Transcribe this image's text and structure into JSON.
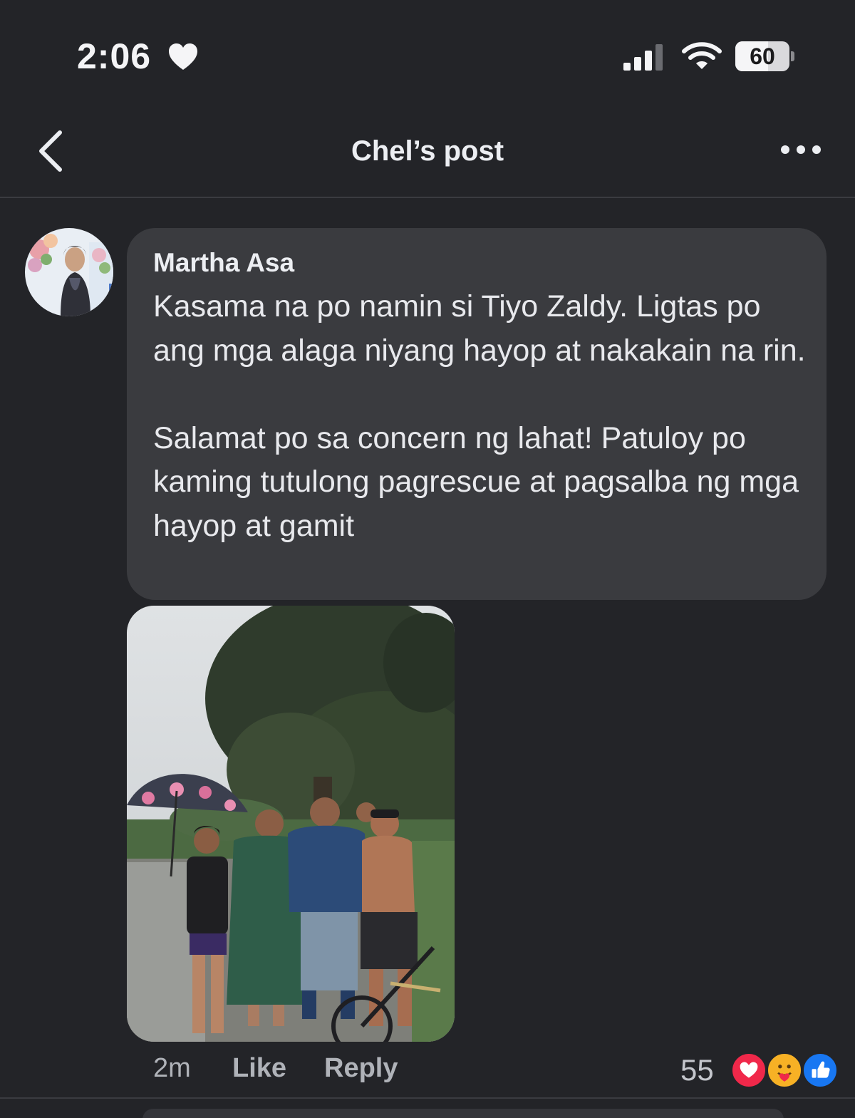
{
  "status_bar": {
    "time": "2:06",
    "battery_level": "60",
    "battery_fraction": 0.6,
    "icons": [
      "heart-icon",
      "signal-icon",
      "wifi-icon",
      "battery-icon"
    ]
  },
  "nav": {
    "title": "Chel’s post",
    "back_icon": "chevron-left-icon",
    "more_icon": "more-horizontal-icon"
  },
  "comment": {
    "author": "Martha Asa",
    "paragraphs": [
      "Kasama na po namin si Tiyo Zaldy. Ligtas po ang mga alaga niyang hayop at nakakain na rin.",
      "Salamat po sa concern ng lahat! Patuloy po kaming tutulong pagrescue at pagsalba ng mga hayop at gamit"
    ],
    "time_ago": "2m",
    "like_label": "Like",
    "reply_label": "Reply",
    "reaction_count": "55",
    "reactions": [
      "love-reaction-icon",
      "care-reaction-icon",
      "like-reaction-icon"
    ]
  },
  "colors": {
    "background": "#232428",
    "bubble": "#3a3b3f",
    "love": "#f0284a",
    "care": "#f7b125",
    "like": "#1877f2"
  }
}
